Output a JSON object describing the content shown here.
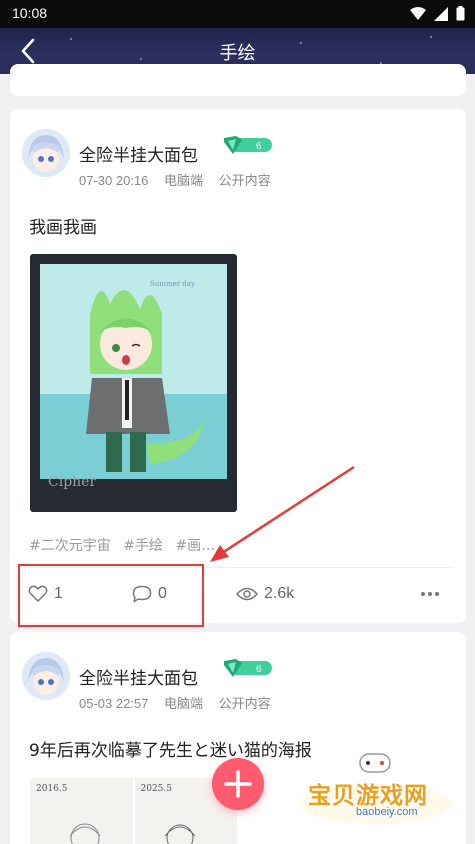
{
  "status_bar": {
    "time": "10:08"
  },
  "nav": {
    "title": "手绘"
  },
  "posts": [
    {
      "author": "全险半挂大面包",
      "level": "6",
      "date": "07-30 20:16",
      "device": "电脑端",
      "visibility": "公开内容",
      "text": "我画我画",
      "artwork_text": "Cipher",
      "tags": [
        "#二次元宇宙",
        "#手绘",
        "#画…"
      ],
      "likes": "1",
      "comments": "0",
      "views": "2.6k"
    },
    {
      "author": "全险半挂大面包",
      "level": "6",
      "date": "05-03 22:57",
      "device": "电脑端",
      "visibility": "公开内容",
      "text": "9年后再次临摹了先生と迷い猫的海报",
      "thumb_labels": [
        "2016.5",
        "2025.5"
      ]
    }
  ],
  "watermark": {
    "cn": "宝贝游戏网",
    "en": "baobeiy.com"
  },
  "colors": {
    "accent": "#ff5b6e",
    "highlight": "#e23b3b",
    "badge": "#2bbf8f"
  }
}
